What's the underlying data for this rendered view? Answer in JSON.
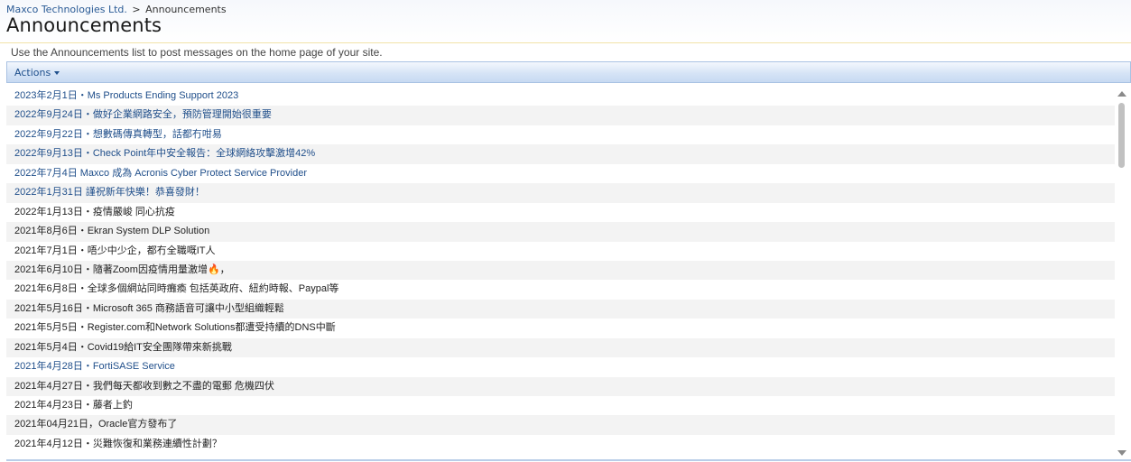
{
  "breadcrumb": {
    "site": "Maxco Technologies Ltd.",
    "separator": ">",
    "current": "Announcements"
  },
  "page": {
    "title": "Announcements",
    "description": "Use the Announcements list to post messages on the home page of your site."
  },
  "toolbar": {
    "actions_label": "Actions"
  },
  "colors": {
    "link": "#1f4e8a",
    "text": "#222222",
    "toolbar_border": "#a9c2e3",
    "alt_row": "#f3f3f3"
  },
  "announcements": [
    {
      "text": "2023年2月1日・Ms Products Ending Support 2023",
      "link": true
    },
    {
      "text": "2022年9月24日・做好企業網路安全，預防管理開始很重要",
      "link": true
    },
    {
      "text": "2022年9月22日・想數碼傳真轉型，話都冇咁易",
      "link": true
    },
    {
      "text": "2022年9月13日・Check Point年中安全報告：全球網絡攻擊激增42%",
      "link": true
    },
    {
      "text": "2022年7月4日 Maxco 成為 Acronis Cyber Protect Service Provider",
      "link": true
    },
    {
      "text": "2022年1月31日 謹祝新年快樂！恭喜發財！",
      "link": true
    },
    {
      "text": "2022年1月13日・疫情嚴峻 同心抗疫",
      "link": false
    },
    {
      "text": "2021年8月6日・Ekran System DLP Solution",
      "link": false
    },
    {
      "text": "2021年7月1日・唔少中少企，都冇全職嘅IT人",
      "link": false
    },
    {
      "text": "2021年6月10日・隨著Zoom因疫情用量激增🔥，",
      "link": false
    },
    {
      "text": "2021年6月8日・全球多個網站同時癱瘓 包括英政府、紐約時報、Paypal等",
      "link": false
    },
    {
      "text": "2021年5月16日・Microsoft 365 商務語音可讓中小型組織輕鬆",
      "link": false
    },
    {
      "text": "2021年5月5日・Register.com和Network Solutions都遭受持續的DNS中斷",
      "link": false
    },
    {
      "text": "2021年5月4日・Covid19給IT安全團隊帶來新挑戰",
      "link": false
    },
    {
      "text": "2021年4月28日・FortiSASE Service",
      "link": true
    },
    {
      "text": "2021年4月27日・我們每天都收到數之不盡的電郵 危機四伏",
      "link": false
    },
    {
      "text": "2021年4月23日・藤者上釣",
      "link": false
    },
    {
      "text": "2021年04月21日，Oracle官方發布了",
      "link": false
    },
    {
      "text": "2021年4月12日・災難恢復和業務連續性計劃？",
      "link": false
    }
  ]
}
